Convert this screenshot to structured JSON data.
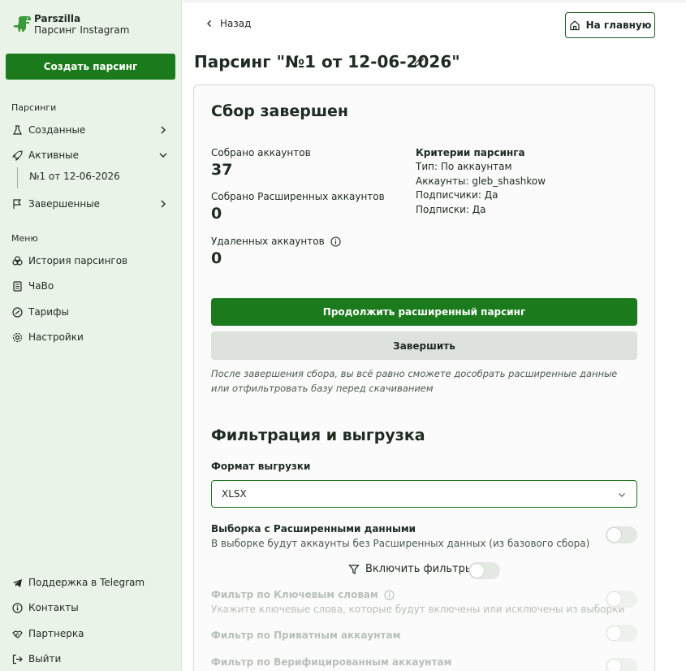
{
  "brand": {
    "name": "Parszilla",
    "subtitle": "Парсинг Instagram"
  },
  "sidebar": {
    "create_button": "Создать парсинг",
    "parsings_section": "Парсинги",
    "parsings": [
      {
        "label": "Созданные",
        "icon": "flask-icon"
      },
      {
        "label": "Активные",
        "icon": "rocket-icon"
      },
      {
        "label": "Завершенные",
        "icon": "flag-icon"
      }
    ],
    "active_sub_item": "№1 от 12-06-2026",
    "menu_section": "Меню",
    "menu": [
      {
        "label": "История парсингов",
        "icon": "history-icon"
      },
      {
        "label": "ЧаВо",
        "icon": "faq-icon"
      },
      {
        "label": "Тарифы",
        "icon": "tariff-icon"
      },
      {
        "label": "Настройки",
        "icon": "settings-icon"
      }
    ],
    "footer": [
      {
        "label": "Поддержка в Telegram",
        "icon": "telegram-icon"
      },
      {
        "label": "Контакты",
        "icon": "info-icon"
      },
      {
        "label": "Партнерка",
        "icon": "handshake-icon"
      },
      {
        "label": "Выйти",
        "icon": "logout-icon"
      }
    ]
  },
  "header": {
    "back_label": "Назад",
    "home_button": "На главную",
    "title": "Парсинг \"№1 от 12-06-2026\""
  },
  "collection": {
    "heading": "Сбор завершен",
    "collected_accounts_label": "Собрано аккаунтов",
    "collected_accounts_value": "37",
    "extended_accounts_label": "Собрано Расширенных аккаунтов",
    "extended_accounts_value": "0",
    "deleted_accounts_label": "Удаленных аккаунтов",
    "deleted_accounts_value": "0",
    "criteria_title": "Критерии парсинга",
    "criteria": [
      "Тип: По аккаунтам",
      "Аккаунты: gleb_shashkow",
      "Подписчики: Да",
      "Подписки: Да"
    ],
    "continue_button": "Продолжить расширенный парсинг",
    "finish_button": "Завершить",
    "note": "После завершения сбора, вы всё равно сможете дособрать расширенные данные или отфильтровать базу перед скачиванием"
  },
  "export": {
    "heading": "Фильтрация и выгрузка",
    "format_label": "Формат выгрузки",
    "format_value": "XLSX",
    "extended_title": "Выборка с Расширенными данными",
    "extended_sub": "В выборке будут аккаунты без Расширенных данных (из базового сбора)",
    "enable_filters_label": "Включить фильтры",
    "keywords_title": "Фильтр по Ключевым словам",
    "keywords_sub": "Укажите ключевые слова, которые будут включены или исключены из выборки",
    "private_title": "Фильтр по Приватным аккаунтам",
    "verified_title": "Фильтр по Верифицированным аккаунтам"
  },
  "colors": {
    "accent": "#1b7a1b",
    "sidebar_bg": "#eaf3e8",
    "secondary": "#dde3dc"
  }
}
